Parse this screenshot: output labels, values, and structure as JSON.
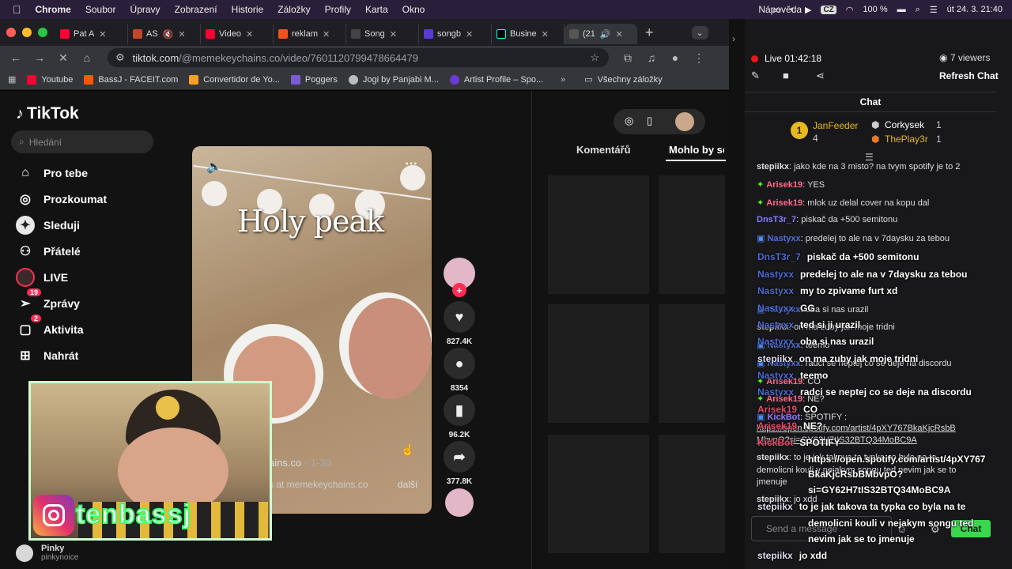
{
  "menubar": {
    "app": "Chrome",
    "items": [
      "Soubor",
      "Úpravy",
      "Zobrazení",
      "Historie",
      "Záložky",
      "Profily",
      "Karta",
      "Okno",
      "Nápověda"
    ],
    "battery": "100 %",
    "lang": "CZ",
    "datetime": "út 24. 3.  21:40"
  },
  "tabs": [
    {
      "label": "Pat A",
      "color": "#ff0033"
    },
    {
      "label": "AS",
      "color": "#c2462a"
    },
    {
      "label": "Video",
      "color": "#ff0033"
    },
    {
      "label": "reklam",
      "color": "#f4511e"
    },
    {
      "label": "Song",
      "color": "#444444"
    },
    {
      "label": "songb",
      "color": "#5b3bd6"
    },
    {
      "label": "Busine",
      "color": "#000000"
    },
    {
      "label": "(21",
      "color": "#555555"
    }
  ],
  "toolbar": {
    "url_host": "tiktok.com",
    "url_path": "/@memekeychains.co/video/7601120799478664479"
  },
  "bookmarks": [
    {
      "label": "Youtube",
      "color": "#ff0033"
    },
    {
      "label": "BassJ - FACEIT.com",
      "color": "#ff5500"
    },
    {
      "label": "Convertidor de Yo...",
      "color": "#f4a023"
    },
    {
      "label": "Poggers",
      "color": "#7b5cd6"
    },
    {
      "label": "Jogi by Panjabi M...",
      "color": "#bbbbbb"
    },
    {
      "label": "Artist Profile – Spo...",
      "color": "#6b3bd6"
    }
  ],
  "bookmarks_all": "Všechny záložky",
  "tiktok": {
    "logo": "TikTok",
    "search_placeholder": "Hledání",
    "nav": [
      {
        "label": "Pro tebe",
        "icon": "home-icon",
        "badge": ""
      },
      {
        "label": "Prozkoumat",
        "icon": "compass-icon",
        "badge": ""
      },
      {
        "label": "Sleduji",
        "icon": "following-icon",
        "badge": ""
      },
      {
        "label": "Přátelé",
        "icon": "friends-icon",
        "badge": ""
      },
      {
        "label": "LIVE",
        "icon": "live-icon",
        "badge": ""
      },
      {
        "label": "Zprávy",
        "icon": "messages-icon",
        "badge": "19"
      },
      {
        "label": "Aktivita",
        "icon": "activity-icon",
        "badge": "2"
      },
      {
        "label": "Nahrát",
        "icon": "upload-icon",
        "badge": ""
      }
    ],
    "following_account": "Pinky",
    "following_handle": "pinkynoice",
    "video_overlay_text": "Holy peak",
    "caption_author": "ains.co",
    "caption_date": " · 1-30",
    "caption_text": "s at memekeychains.co",
    "caption_more": "další",
    "actions": {
      "likes": "827.4K",
      "comments": "8354",
      "saves": "96.2K",
      "shares": "377.8K"
    },
    "right_tabs": [
      "Komentářů",
      "Mohlo by se"
    ]
  },
  "webcam": {
    "instagram_handle": "tenbassj"
  },
  "stream": {
    "uptime": "Live 01:42:18",
    "viewers": "7 viewers",
    "refresh": "Refresh Chat",
    "chat_title": "Chat",
    "leaderboard": [
      {
        "name": "JanFeeder",
        "count": "4"
      },
      {
        "name": "Corkysek",
        "count": "1"
      },
      {
        "name": "ThePlay3r",
        "count": "1"
      }
    ],
    "chat_lines": [
      {
        "user": "stepiikx",
        "text": "jako kde na 3 misto? na tvym spotify je to 2",
        "cls": "u1"
      },
      {
        "user": "Arisek19",
        "text": "YES",
        "cls": "u2"
      },
      {
        "user": "Arisek19",
        "text": "mlok uz delal cover na kopu dal",
        "cls": "u2"
      },
      {
        "user": "DnsT3r_7",
        "text": "piskač da +500 semitonu",
        "cls": "u3"
      },
      {
        "user": "Nastyxx",
        "text": "predelej to ale na v 7daysku za tebou",
        "cls": "u4"
      },
      {
        "user": "Nastyxx",
        "text": "oba si nas urazil",
        "cls": "u4"
      },
      {
        "user": "stepiikx",
        "text": "on ma zuby jak moje tridni",
        "cls": "u1"
      },
      {
        "user": "Nastyxx",
        "text": "teemo",
        "cls": "u4"
      },
      {
        "user": "Nastyxx",
        "text": "radci se neptej co se deje na discordu",
        "cls": "u4"
      },
      {
        "user": "Arisek19",
        "text": "CO",
        "cls": "u2"
      },
      {
        "user": "Arisek19",
        "text": "NE?",
        "cls": "u2"
      },
      {
        "user": "KickBot",
        "text": "SPOTIFY :",
        "cls": "u3"
      },
      {
        "user": "",
        "text": "https://open.spotify.com/artist/4pXY767BkaKjcRsbB",
        "cls": "u1"
      },
      {
        "user": "",
        "text": "MbvpO?si=GY62H7tIS32BTQ34MoBC9A",
        "cls": "u1"
      },
      {
        "user": "stepiikx",
        "text": "to je jak takova ta typka co byla na te",
        "cls": "u1"
      },
      {
        "user": "",
        "text": "demolicni kouli v nejakym songu ted nevim jak se to",
        "cls": "u1"
      },
      {
        "user": "",
        "text": "jmenuje",
        "cls": "u1"
      },
      {
        "user": "stepiikx",
        "text": "jo xdd",
        "cls": "u1"
      }
    ],
    "overlay_lines": [
      {
        "user": "DnsT3r_7",
        "text": "piskač da +500 semitonu",
        "cls": "n1"
      },
      {
        "user": "Nastyxx",
        "text": "predelej to ale na v 7daysku za tebou",
        "cls": "n1"
      },
      {
        "user": "Nastyxx",
        "text": "my to zpivame furt xd",
        "cls": "n1"
      },
      {
        "user": "Nastyxx",
        "text": "GG",
        "cls": "n1"
      },
      {
        "user": "Nastyxx",
        "text": "ted si ji urazil",
        "cls": "n1"
      },
      {
        "user": "Nastyxx",
        "text": "oba si nas urazil",
        "cls": "n1"
      },
      {
        "user": "stepiikx",
        "text": "on ma zuby jak moje tridni",
        "cls": "n2"
      },
      {
        "user": "Nastyxx",
        "text": "teemo",
        "cls": "n1"
      },
      {
        "user": "Nastyxx",
        "text": "radci se neptej co se deje na discordu",
        "cls": "n1"
      },
      {
        "user": "Arisek19",
        "text": "CO",
        "cls": "n3"
      },
      {
        "user": "Arisek19",
        "text": "NE?",
        "cls": "n3"
      },
      {
        "user": "KickBot",
        "text": "SPOTIFY",
        "cls": "n3"
      },
      {
        "user": "",
        "text": "https://open.spotify.com/artist/4pXY767",
        "cls": "n2"
      },
      {
        "user": "",
        "text": "BkaKjcRsbBMbvpO?",
        "cls": "n2"
      },
      {
        "user": "",
        "text": "si=GY62H7tIS32BTQ34MoBC9A",
        "cls": "n2"
      },
      {
        "user": "stepiikx",
        "text": "to je jak takova ta typka co byla na te",
        "cls": "n2"
      },
      {
        "user": "",
        "text": "demolicni kouli v nejakym songu ted",
        "cls": "n2"
      },
      {
        "user": "",
        "text": "nevim jak se to jmenuje",
        "cls": "n2"
      },
      {
        "user": "stepiikx",
        "text": "jo xdd",
        "cls": "n2"
      }
    ],
    "send_placeholder": "Send a message",
    "chat_button": "Chat"
  }
}
